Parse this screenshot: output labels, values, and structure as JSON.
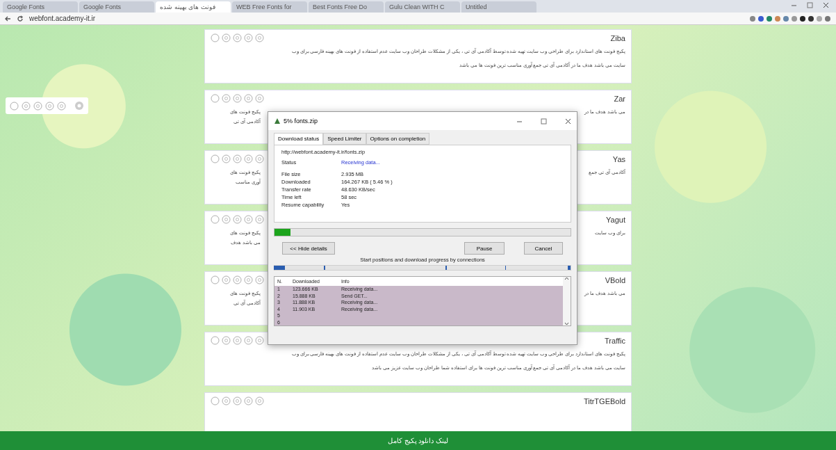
{
  "browser": {
    "tabs": [
      {
        "label": "Google Fonts",
        "selected": false
      },
      {
        "label": "Google Fonts",
        "selected": false
      },
      {
        "label": "فونت های بهینه شده",
        "selected": true
      },
      {
        "label": "WEB Free Fonts for",
        "selected": false
      },
      {
        "label": "Best Fonts Free Do",
        "selected": false
      },
      {
        "label": "Gulu Clean WITH C",
        "selected": false
      },
      {
        "label": "Untitled",
        "selected": false
      }
    ],
    "address": "webfont.academy-it.ir"
  },
  "cards": [
    {
      "name": "Ziba",
      "lines": [
        "پکیج فونت های استاندارد برای طراحی وب سایت تهیه شده توسط آکادمی آی تی ، یکی از مشکلات طراحان وب سایت عدم استفاده از فونت های بهینه فارسی برای وب",
        "سایت می باشد هدف ما در آکادمی آی تی جمع آوری مناسب ترین فونت ها می باشد"
      ],
      "kind": "full"
    },
    {
      "name": "Zar",
      "lines": [
        "پکیج فونت های",
        "آکادمی آی تی"
      ],
      "side": [
        "می باشد هدف ما در"
      ],
      "kind": "split"
    },
    {
      "name": "Yas",
      "lines": [
        "پکیج فونت های",
        "آوری مناسب"
      ],
      "side": [
        "آکادمی آی تی جمع"
      ],
      "kind": "split"
    },
    {
      "name": "Yagut",
      "lines": [
        "پکیج فونت های",
        "می باشد هدف"
      ],
      "side": [
        "برای وب سایت"
      ],
      "kind": "split"
    },
    {
      "name": "VBold",
      "lines": [
        "پکیج فونت های",
        "آکادمی آی تی"
      ],
      "side": [
        "می باشد هدف ما در"
      ],
      "kind": "split"
    },
    {
      "name": "Traffic",
      "lines": [
        "پکیج فونت های استاندارد برای طراحی وب سایت تهیه شده توسط آکادمی آی تی ، یکی از مشکلات طراحان وب سایت عدم استفاده از فونت های بهینه فارسی برای وب",
        "سایت می باشد هدف ما در آکادمی آی تی جمع آوری مناسب ترین فونت ها برای استفاده شما طراحان وب سایت عزیز می باشد"
      ],
      "kind": "full"
    },
    {
      "name": "TitrTGEBold",
      "kind": "full"
    }
  ],
  "dialog": {
    "title": "5% fonts.zip",
    "tabs": [
      {
        "label": "Download status",
        "selected": true
      },
      {
        "label": "Speed Limiter",
        "selected": false
      },
      {
        "label": "Options on completion",
        "selected": false
      }
    ],
    "url": "http://webfont.academy-it.ir/fonts.zip",
    "status": {
      "label": "Status",
      "value": "Receiving data..."
    },
    "fields": [
      {
        "label": "File size",
        "value": "2.935 MB"
      },
      {
        "label": "Downloaded",
        "value": "164.267 KB ( 5.46 % )"
      },
      {
        "label": "Transfer rate",
        "value": "48.630 KB/sec"
      },
      {
        "label": "Time left",
        "value": "58 sec"
      },
      {
        "label": "Resume capability",
        "value": "Yes"
      }
    ],
    "progress": {
      "level": 0.055
    },
    "buttons": {
      "hide": "<< Hide details",
      "pause": "Pause",
      "cancel": "Cancel"
    },
    "connections_label": "Start positions and download progress by connections",
    "table": {
      "columns": [
        "N.",
        "Downloaded",
        "Info"
      ],
      "rows": [
        [
          "1",
          "123.666 KB",
          "Receiving data..."
        ],
        [
          "2",
          "15.888 KB",
          "Send GET..."
        ],
        [
          "3",
          "11.888 KB",
          "Receiving data..."
        ],
        [
          "4",
          "11.903 KB",
          "Receiving data..."
        ],
        [
          "5",
          "",
          ""
        ],
        [
          "6",
          "",
          ""
        ]
      ]
    }
  },
  "footer": "لینک دانلود پکیج کامل"
}
